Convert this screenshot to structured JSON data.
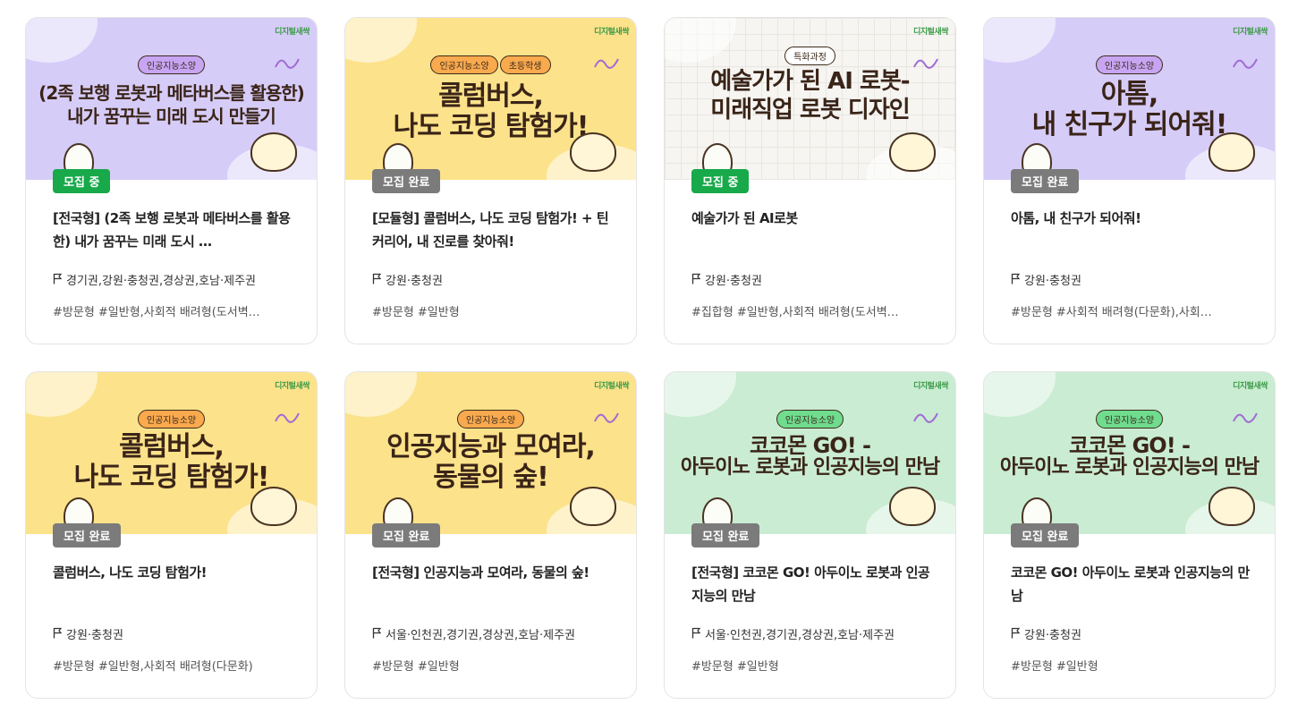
{
  "brand_text": "디지털새싹",
  "cards": [
    {
      "theme": "purple",
      "pills": [
        {
          "text": "인공지능소양",
          "style": "p-purple"
        }
      ],
      "headline": [
        "(2족 보행 로봇과 메타버스를 활용한)",
        "내가 꿈꾸는 미래 도시 만들기"
      ],
      "status": "모집 중",
      "status_type": "open",
      "title": "[전국형] (2족 보행 로봇과 메타버스를 활용한) 내가 꿈꾸는 미래 도시 …",
      "region": "경기권,강원·충청권,경상권,호남·제주권",
      "tags": "#방문형 #일반형,사회적 배려형(도서벽…"
    },
    {
      "theme": "yellow",
      "pills": [
        {
          "text": "인공지능소양",
          "style": "p-orange"
        },
        {
          "text": "초등학생",
          "style": "p-orange"
        }
      ],
      "headline": [
        "콜럼버스,",
        "나도 코딩 탐험가!"
      ],
      "status": "모집 완료",
      "status_type": "closed",
      "title": "[모듈형] 콜럼버스, 나도 코딩 탐험가! + 틴커리어, 내 진로를 찾아줘!",
      "region": "강원·충청권",
      "tags": "#방문형 #일반형"
    },
    {
      "theme": "grid-bg",
      "pills": [
        {
          "text": "특화과정",
          "style": "p-white"
        }
      ],
      "headline": [
        "예술가가 된 AI 로봇-",
        "미래직업 로봇 디자인"
      ],
      "status": "모집 중",
      "status_type": "open",
      "title": "예술가가 된 AI로봇",
      "region": "강원·충청권",
      "tags": "#집합형 #일반형,사회적 배려형(도서벽…"
    },
    {
      "theme": "purple",
      "pills": [
        {
          "text": "인공지능소양",
          "style": "p-purple"
        }
      ],
      "headline": [
        "아톰,",
        "내 친구가 되어줘!"
      ],
      "status": "모집 완료",
      "status_type": "closed",
      "title": "아톰, 내 친구가 되어줘!",
      "region": "강원·충청권",
      "tags": "#방문형 #사회적 배려형(다문화),사회…"
    },
    {
      "theme": "yellow",
      "pills": [
        {
          "text": "인공지능소양",
          "style": "p-orange"
        }
      ],
      "headline": [
        "콜럼버스,",
        "나도 코딩 탐험가!"
      ],
      "status": "모집 완료",
      "status_type": "closed",
      "title": "콜럼버스, 나도 코딩 탐험가!",
      "region": "강원·충청권",
      "tags": "#방문형 #일반형,사회적 배려형(다문화)"
    },
    {
      "theme": "yellow",
      "pills": [
        {
          "text": "인공지능소양",
          "style": "p-orange"
        }
      ],
      "headline": [
        "인공지능과 모여라,",
        "동물의 숲!"
      ],
      "status": "모집 완료",
      "status_type": "closed",
      "title": "[전국형] 인공지능과 모여라, 동물의 숲!",
      "region": "서울·인천권,경기권,경상권,호남·제주권",
      "tags": "#방문형 #일반형"
    },
    {
      "theme": "green",
      "pills": [
        {
          "text": "인공지능소양",
          "style": "p-green"
        }
      ],
      "headline": [
        "코코몬 GO! -",
        "아두이노 로봇과 인공지능의 만남"
      ],
      "status": "모집 완료",
      "status_type": "closed",
      "title": "[전국형] 코코몬 GO! 아두이노 로봇과 인공지능의 만남",
      "region": "서울·인천권,경기권,경상권,호남·제주권",
      "tags": "#방문형 #일반형"
    },
    {
      "theme": "green",
      "pills": [
        {
          "text": "인공지능소양",
          "style": "p-green"
        }
      ],
      "headline": [
        "코코몬 GO! -",
        "아두이노 로봇과 인공지능의 만남"
      ],
      "status": "모집 완료",
      "status_type": "closed",
      "title": "코코몬 GO! 아두이노 로봇과 인공지능의 만남",
      "region": "강원·충청권",
      "tags": "#방문형 #일반형"
    }
  ],
  "colors": {
    "open_badge": "#17a94a",
    "closed_badge": "#7b7b7b",
    "purple_banner": "#d6ccf8",
    "yellow_banner": "#fce28a",
    "green_banner": "#c9ecd2"
  }
}
